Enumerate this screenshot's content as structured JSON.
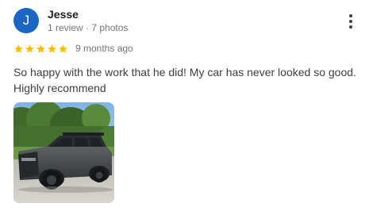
{
  "review": {
    "author": {
      "initial": "J",
      "name": "Jesse",
      "meta": "1 review · 7 photos",
      "avatar_color": "#1a66c2"
    },
    "rating": 5,
    "max_rating": 5,
    "star_color": "#fbbc04",
    "date": "9 months ago",
    "text": "So happy with the work that he did! My car has never looked so good. Highly recommend",
    "photos": [
      {
        "subject": "dark gray SUV parked on driveway with trees behind"
      }
    ],
    "menu_icon": "more-vert-icon"
  }
}
